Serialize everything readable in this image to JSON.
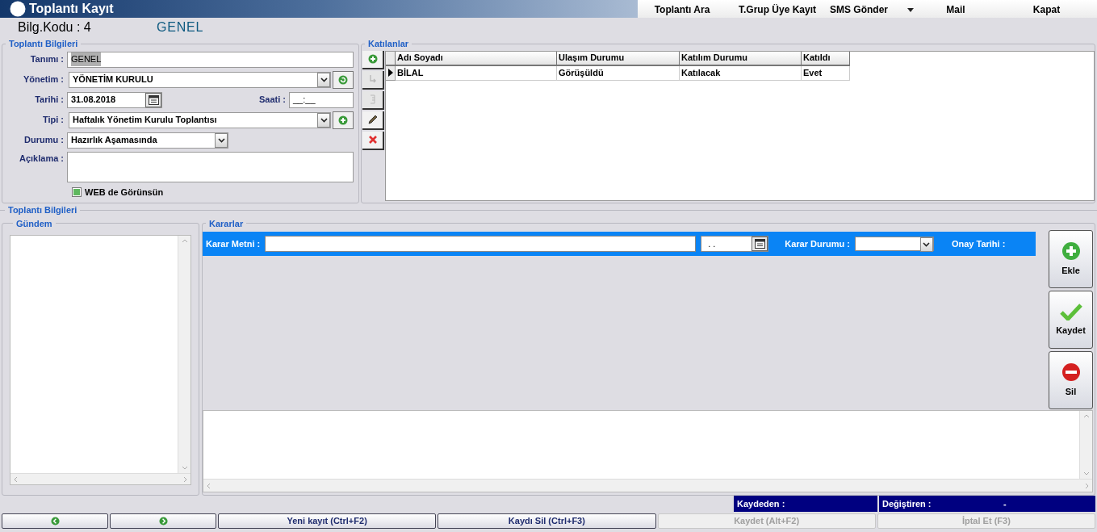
{
  "window": {
    "title": "Toplantı Kayıt"
  },
  "menu": [
    {
      "label": "Toplantı Ara",
      "kind": "item"
    },
    {
      "label": "T.Grup Üye Kayıt",
      "kind": "item"
    },
    {
      "label": "SMS Gönder",
      "kind": "dropdown"
    },
    {
      "label": "Mail",
      "kind": "item"
    },
    {
      "label": "Kapat",
      "kind": "item"
    }
  ],
  "header": {
    "code": "Bilg.Kodu : 4",
    "name": "GENEL"
  },
  "meeting_info": {
    "title": "Toplantı Bilgileri",
    "tanimi": {
      "label": "Tanımı :",
      "value": "GENEL",
      "selected": true
    },
    "yonetim": {
      "label": "Yönetim :",
      "value": "YÖNETİM KURULU"
    },
    "tarihi": {
      "label": "Tarihi :",
      "value": "31.08.2018"
    },
    "saati": {
      "label": "Saati :",
      "value": "__:__"
    },
    "tipi": {
      "label": "Tipi :",
      "value": "Haftalık Yönetim Kurulu Toplantısı"
    },
    "durumu": {
      "label": "Durumu :",
      "value": "Hazırlık Aşamasında"
    },
    "aciklama": {
      "label": "Açıklama :"
    },
    "web": {
      "label": "WEB de Görünsün",
      "checked": true
    }
  },
  "participants": {
    "title": "Katılanlar",
    "tools": [
      {
        "kind": "add",
        "disabled": false
      },
      {
        "kind": "move",
        "disabled": true
      },
      {
        "kind": "list",
        "disabled": true
      },
      {
        "kind": "edit",
        "disabled": false
      },
      {
        "kind": "delete",
        "disabled": false
      }
    ],
    "columns": [
      "Adı Soyadı",
      "Ulaşım Durumu",
      "Katılım Durumu",
      "Katıldı"
    ],
    "rows": [
      {
        "cells": [
          "BİLAL",
          "Görüşüldü",
          "Katılacak",
          "Evet"
        ],
        "selected": true
      }
    ]
  },
  "details": {
    "title": "Toplantı Bilgileri",
    "agenda": {
      "title": "Gündem"
    },
    "decisions": {
      "title": "Kararlar",
      "text_label": "Karar Metni :",
      "date_value": ". .",
      "status_label": "Karar Durumu :",
      "approval_label": "Onay Tarihi :"
    },
    "actions": [
      {
        "kind": "add",
        "label": "Ekle"
      },
      {
        "kind": "save",
        "label": "Kaydet"
      },
      {
        "kind": "delete",
        "label": "Sil"
      }
    ]
  },
  "status_bar": {
    "created_by": "Kaydeden :",
    "changed_by": "Değiştiren :",
    "changed_value": "-"
  },
  "bottom_buttons": [
    {
      "kind": "prev",
      "disabled": false
    },
    {
      "kind": "next",
      "disabled": false
    },
    {
      "kind": "text",
      "label": "Yeni kayıt (Ctrl+F2)",
      "disabled": false
    },
    {
      "kind": "text",
      "label": "Kaydı Sil (Ctrl+F3)",
      "disabled": false
    },
    {
      "kind": "text",
      "label": "Kaydet (Alt+F2)",
      "disabled": true
    },
    {
      "kind": "text",
      "label": "İptal Et (F3)",
      "disabled": true
    }
  ]
}
